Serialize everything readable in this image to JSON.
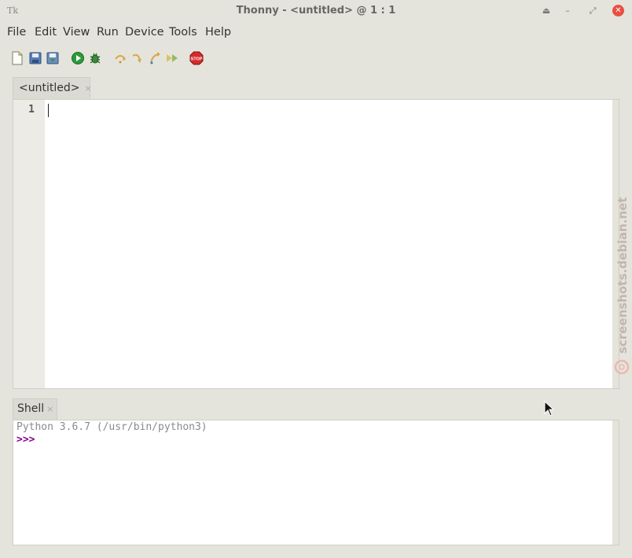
{
  "window": {
    "title": "Thonny  -  <untitled>  @  1 : 1",
    "app_icon": "Tk",
    "controls": [
      "restore-up-icon",
      "minimize-icon",
      "maximize-icon",
      "close-icon"
    ]
  },
  "menu": {
    "file": "File",
    "edit": "Edit",
    "view": "View",
    "run": "Run",
    "device": "Device",
    "tools": "Tools",
    "help": "Help"
  },
  "toolbar": {
    "buttons": [
      "new-file-icon",
      "open-file-icon",
      "save-file-icon",
      "run-icon",
      "debug-icon",
      "step-over-icon",
      "step-into-icon",
      "step-out-icon",
      "resume-icon",
      "stop-icon"
    ],
    "stop_label": "STOP"
  },
  "editor": {
    "tab_label": "<untitled>",
    "tab_close": "×",
    "line_numbers": [
      "1"
    ]
  },
  "shell": {
    "tab_label": "Shell",
    "tab_close": "×",
    "version_line": "Python 3.6.7 (/usr/bin/python3)",
    "prompt": ">>>"
  },
  "watermark": {
    "text": "screenshots.debian.net"
  },
  "colors": {
    "background": "#e5e4dc",
    "run_green": "#2c9a3a",
    "stop_red": "#d42a2a",
    "prompt_purple": "#8b008b",
    "close_red": "#e94e43"
  }
}
